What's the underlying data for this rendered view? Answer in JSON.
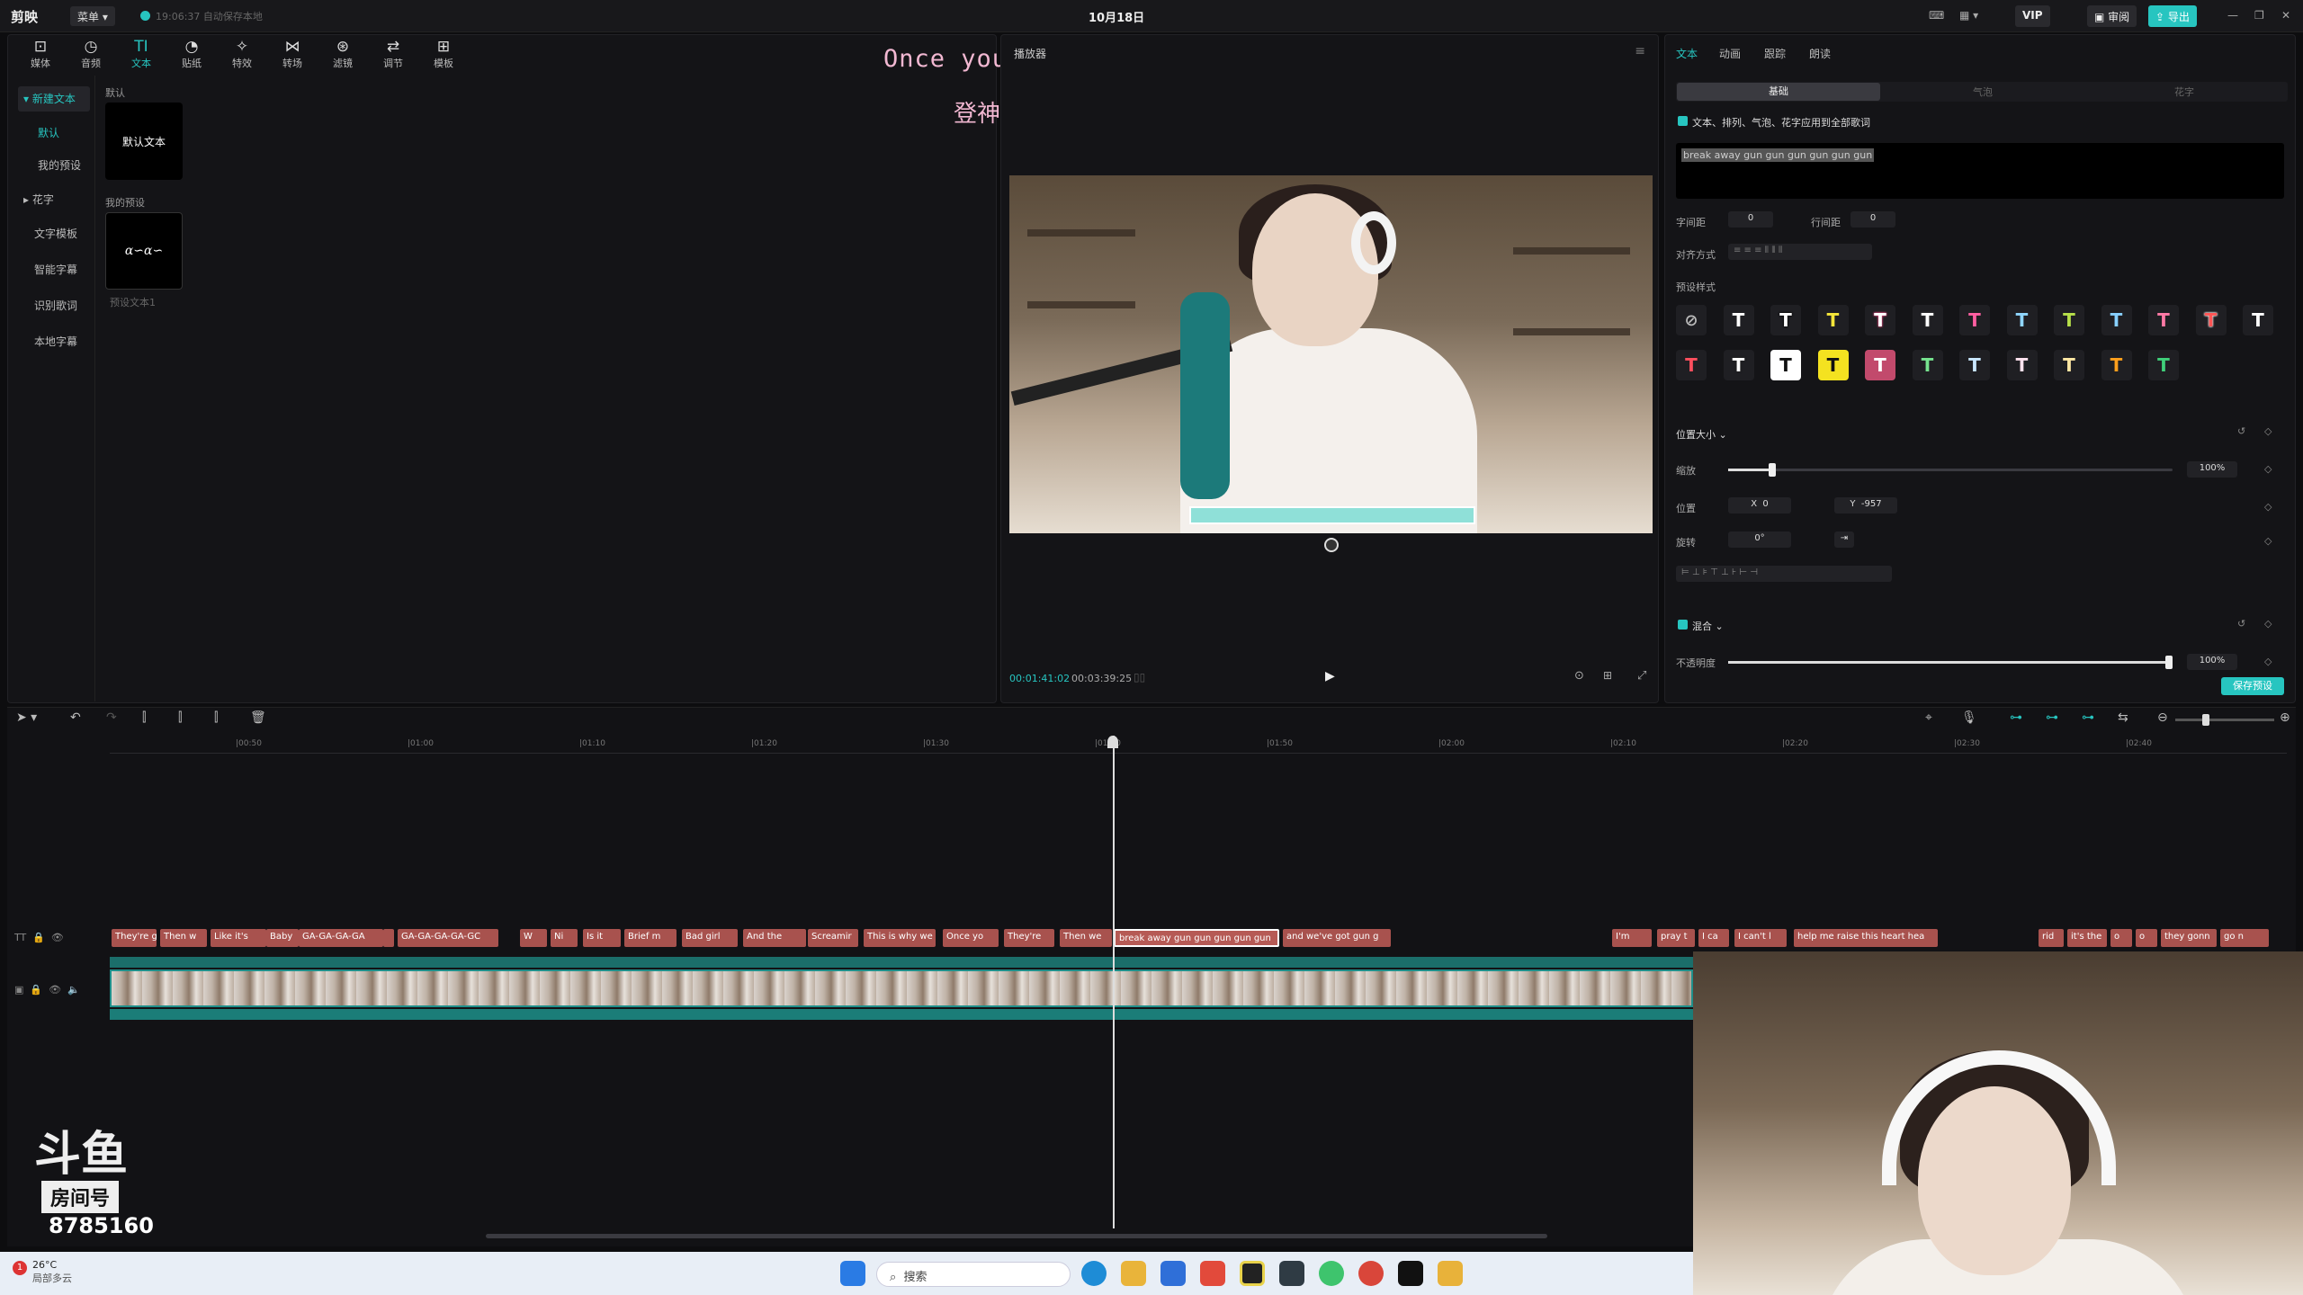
{
  "app": {
    "name": "剪映",
    "menu_label": "菜单",
    "autosave": "19:06:37 自动保存本地",
    "date": "10月18日",
    "vip": "VIP",
    "review": "审阅",
    "export": "导出"
  },
  "toolbar": [
    {
      "label": "媒体",
      "icon": "media-icon"
    },
    {
      "label": "音频",
      "icon": "audio-icon"
    },
    {
      "label": "文本",
      "icon": "text-icon"
    },
    {
      "label": "贴纸",
      "icon": "sticker-icon"
    },
    {
      "label": "特效",
      "icon": "effects-icon"
    },
    {
      "label": "转场",
      "icon": "transition-icon"
    },
    {
      "label": "滤镜",
      "icon": "filter-icon"
    },
    {
      "label": "调节",
      "icon": "adjust-icon"
    },
    {
      "label": "模板",
      "icon": "template-icon"
    }
  ],
  "leftnav": [
    "新建文本",
    "默认",
    "我的预设",
    "花字",
    "文字模板",
    "智能字幕",
    "识别歌词",
    "本地字幕"
  ],
  "library": {
    "default_section": "默认",
    "default_card": "默认文本",
    "preset_section": "我的预设",
    "preset_card_label": "预设文本1"
  },
  "overlay": {
    "line1": "Once you play",
    "line2": "登神"
  },
  "preview": {
    "title": "播放器",
    "current_time": "00:01:41:02",
    "total_time": "00:03:39:25"
  },
  "props": {
    "tabs": [
      "文本",
      "动画",
      "跟踪",
      "朗读"
    ],
    "subtabs": [
      "基础",
      "气泡",
      "花字"
    ],
    "apply_all": "文本、排列、气泡、花字应用到全部歌词",
    "text_value": "break away gun gun gun gun gun gun",
    "char_spacing_label": "字间距",
    "char_spacing": "0",
    "line_spacing_label": "行间距",
    "line_spacing": "0",
    "align_label": "对齐方式",
    "preset_label": "预设样式",
    "pos_size_label": "位置大小",
    "scale_label": "缩放",
    "scale": "100%",
    "scale_value": 0.1,
    "pos_label": "位置",
    "x": "0",
    "y": "-957",
    "rotate_label": "旋转",
    "rotate": "0°",
    "blend_label": "混合",
    "opacity_label": "不透明度",
    "opacity": "100%",
    "opacity_value": 1.0,
    "save_preset": "保存预设"
  },
  "presets": [
    {
      "fg": "#ffffff",
      "bg": "#1f1f23",
      "border": ""
    },
    {
      "fg": "#ffffff",
      "bg": "#1f1f23",
      "border": "#000"
    },
    {
      "fg": "#f5e63a",
      "bg": "#1f1f23",
      "border": ""
    },
    {
      "fg": "#ffffff",
      "bg": "#1f1f23",
      "border": "#e0457b"
    },
    {
      "fg": "#ffffff",
      "bg": "#1f1f23",
      "border": "#3a3a3a"
    },
    {
      "fg": "#ff5fa2",
      "bg": "#1f1f23",
      "border": ""
    },
    {
      "fg": "#8fd6ff",
      "bg": "#1f1f23",
      "border": ""
    },
    {
      "fg": "#b7e04a",
      "bg": "#1f1f23",
      "border": ""
    },
    {
      "fg": "#88d0ff",
      "bg": "#1f1f23",
      "border": ""
    },
    {
      "fg": "#ff7aa6",
      "bg": "#1f1f23",
      "border": ""
    },
    {
      "fg": "#ff5555",
      "bg": "#1f1f23",
      "border": "#fff"
    },
    {
      "fg": "#ffffff",
      "bg": "#1f1f23",
      "border": ""
    },
    {
      "fg": "#ff4f5e",
      "bg": "#1f1f23",
      "border": ""
    },
    {
      "fg": "#ffffff",
      "bg": "#1f1f23",
      "border": "#222"
    },
    {
      "fg": "#111111",
      "bg": "#ffffff",
      "border": ""
    },
    {
      "fg": "#111111",
      "bg": "#f4e220",
      "border": ""
    },
    {
      "fg": "#ffffff",
      "bg": "#c24a6c",
      "border": ""
    },
    {
      "fg": "#76e38f",
      "bg": "#1f1f23",
      "border": ""
    },
    {
      "fg": "#c9e7ff",
      "bg": "#1f1f23",
      "border": ""
    },
    {
      "fg": "#ffe2ef",
      "bg": "#1f1f23",
      "border": ""
    },
    {
      "fg": "#ffe8a4",
      "bg": "#1f1f23",
      "border": ""
    },
    {
      "fg": "#ff9f1c",
      "bg": "#1f1f23",
      "border": ""
    },
    {
      "fg": "#3fd07a",
      "bg": "#1f1f23",
      "border": ""
    }
  ],
  "ruler": [
    "00:50",
    "01:00",
    "01:10",
    "01:20",
    "01:30",
    "01:40",
    "01:50",
    "02:00",
    "02:10",
    "02:20",
    "02:30",
    "02:40"
  ],
  "clips": [
    {
      "text": "They're g"
    },
    {
      "text": "Then w"
    },
    {
      "text": "Like it's"
    },
    {
      "text": "Baby"
    },
    {
      "text": "GA-GA-GA-GA"
    },
    {
      "text": ""
    },
    {
      "text": "GA-GA-GA-GA-GC"
    },
    {
      "text": "W"
    },
    {
      "text": "Ni"
    },
    {
      "text": "Is it"
    },
    {
      "text": "Brief m"
    },
    {
      "text": "Bad girl"
    },
    {
      "text": "And the"
    },
    {
      "text": "Screamir"
    },
    {
      "text": "This is why we"
    },
    {
      "text": "Once yo"
    },
    {
      "text": "They're"
    },
    {
      "text": "Then we"
    },
    {
      "text": "break away gun gun gun gun gun"
    },
    {
      "text": "and we've got gun g"
    },
    {
      "text": "I'm"
    },
    {
      "text": "pray t"
    },
    {
      "text": "I ca"
    },
    {
      "text": "I can't l"
    },
    {
      "text": "help me raise this heart hea"
    },
    {
      "text": "rid"
    },
    {
      "text": "it's the"
    },
    {
      "text": "o"
    },
    {
      "text": "o"
    },
    {
      "text": "they gonn"
    },
    {
      "text": "go n"
    }
  ],
  "douyu": {
    "mark": "斗鱼",
    "room": "房间号",
    "number": "8785160"
  },
  "taskbar": {
    "temp": "26°C",
    "weather": "局部多云",
    "search": "搜索"
  }
}
